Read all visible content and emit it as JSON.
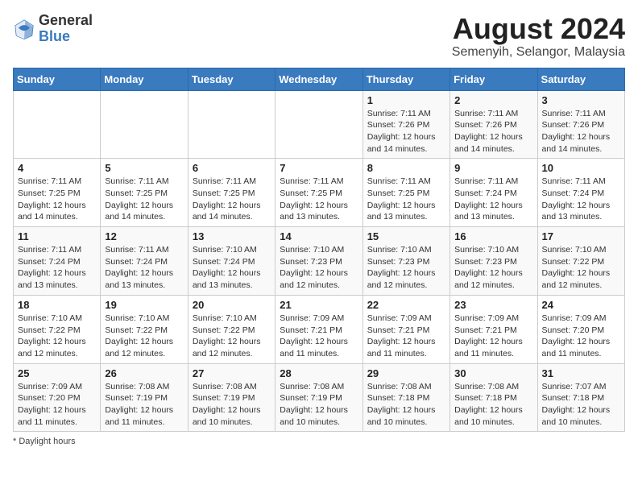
{
  "header": {
    "logo_general": "General",
    "logo_blue": "Blue",
    "month_year": "August 2024",
    "location": "Semenyih, Selangor, Malaysia"
  },
  "weekdays": [
    "Sunday",
    "Monday",
    "Tuesday",
    "Wednesday",
    "Thursday",
    "Friday",
    "Saturday"
  ],
  "weeks": [
    [
      {
        "day": "",
        "info": ""
      },
      {
        "day": "",
        "info": ""
      },
      {
        "day": "",
        "info": ""
      },
      {
        "day": "",
        "info": ""
      },
      {
        "day": "1",
        "info": "Sunrise: 7:11 AM\nSunset: 7:26 PM\nDaylight: 12 hours\nand 14 minutes."
      },
      {
        "day": "2",
        "info": "Sunrise: 7:11 AM\nSunset: 7:26 PM\nDaylight: 12 hours\nand 14 minutes."
      },
      {
        "day": "3",
        "info": "Sunrise: 7:11 AM\nSunset: 7:26 PM\nDaylight: 12 hours\nand 14 minutes."
      }
    ],
    [
      {
        "day": "4",
        "info": "Sunrise: 7:11 AM\nSunset: 7:25 PM\nDaylight: 12 hours\nand 14 minutes."
      },
      {
        "day": "5",
        "info": "Sunrise: 7:11 AM\nSunset: 7:25 PM\nDaylight: 12 hours\nand 14 minutes."
      },
      {
        "day": "6",
        "info": "Sunrise: 7:11 AM\nSunset: 7:25 PM\nDaylight: 12 hours\nand 14 minutes."
      },
      {
        "day": "7",
        "info": "Sunrise: 7:11 AM\nSunset: 7:25 PM\nDaylight: 12 hours\nand 13 minutes."
      },
      {
        "day": "8",
        "info": "Sunrise: 7:11 AM\nSunset: 7:25 PM\nDaylight: 12 hours\nand 13 minutes."
      },
      {
        "day": "9",
        "info": "Sunrise: 7:11 AM\nSunset: 7:24 PM\nDaylight: 12 hours\nand 13 minutes."
      },
      {
        "day": "10",
        "info": "Sunrise: 7:11 AM\nSunset: 7:24 PM\nDaylight: 12 hours\nand 13 minutes."
      }
    ],
    [
      {
        "day": "11",
        "info": "Sunrise: 7:11 AM\nSunset: 7:24 PM\nDaylight: 12 hours\nand 13 minutes."
      },
      {
        "day": "12",
        "info": "Sunrise: 7:11 AM\nSunset: 7:24 PM\nDaylight: 12 hours\nand 13 minutes."
      },
      {
        "day": "13",
        "info": "Sunrise: 7:10 AM\nSunset: 7:24 PM\nDaylight: 12 hours\nand 13 minutes."
      },
      {
        "day": "14",
        "info": "Sunrise: 7:10 AM\nSunset: 7:23 PM\nDaylight: 12 hours\nand 12 minutes."
      },
      {
        "day": "15",
        "info": "Sunrise: 7:10 AM\nSunset: 7:23 PM\nDaylight: 12 hours\nand 12 minutes."
      },
      {
        "day": "16",
        "info": "Sunrise: 7:10 AM\nSunset: 7:23 PM\nDaylight: 12 hours\nand 12 minutes."
      },
      {
        "day": "17",
        "info": "Sunrise: 7:10 AM\nSunset: 7:22 PM\nDaylight: 12 hours\nand 12 minutes."
      }
    ],
    [
      {
        "day": "18",
        "info": "Sunrise: 7:10 AM\nSunset: 7:22 PM\nDaylight: 12 hours\nand 12 minutes."
      },
      {
        "day": "19",
        "info": "Sunrise: 7:10 AM\nSunset: 7:22 PM\nDaylight: 12 hours\nand 12 minutes."
      },
      {
        "day": "20",
        "info": "Sunrise: 7:10 AM\nSunset: 7:22 PM\nDaylight: 12 hours\nand 12 minutes."
      },
      {
        "day": "21",
        "info": "Sunrise: 7:09 AM\nSunset: 7:21 PM\nDaylight: 12 hours\nand 11 minutes."
      },
      {
        "day": "22",
        "info": "Sunrise: 7:09 AM\nSunset: 7:21 PM\nDaylight: 12 hours\nand 11 minutes."
      },
      {
        "day": "23",
        "info": "Sunrise: 7:09 AM\nSunset: 7:21 PM\nDaylight: 12 hours\nand 11 minutes."
      },
      {
        "day": "24",
        "info": "Sunrise: 7:09 AM\nSunset: 7:20 PM\nDaylight: 12 hours\nand 11 minutes."
      }
    ],
    [
      {
        "day": "25",
        "info": "Sunrise: 7:09 AM\nSunset: 7:20 PM\nDaylight: 12 hours\nand 11 minutes."
      },
      {
        "day": "26",
        "info": "Sunrise: 7:08 AM\nSunset: 7:19 PM\nDaylight: 12 hours\nand 11 minutes."
      },
      {
        "day": "27",
        "info": "Sunrise: 7:08 AM\nSunset: 7:19 PM\nDaylight: 12 hours\nand 10 minutes."
      },
      {
        "day": "28",
        "info": "Sunrise: 7:08 AM\nSunset: 7:19 PM\nDaylight: 12 hours\nand 10 minutes."
      },
      {
        "day": "29",
        "info": "Sunrise: 7:08 AM\nSunset: 7:18 PM\nDaylight: 12 hours\nand 10 minutes."
      },
      {
        "day": "30",
        "info": "Sunrise: 7:08 AM\nSunset: 7:18 PM\nDaylight: 12 hours\nand 10 minutes."
      },
      {
        "day": "31",
        "info": "Sunrise: 7:07 AM\nSunset: 7:18 PM\nDaylight: 12 hours\nand 10 minutes."
      }
    ]
  ],
  "footer": "Daylight hours"
}
